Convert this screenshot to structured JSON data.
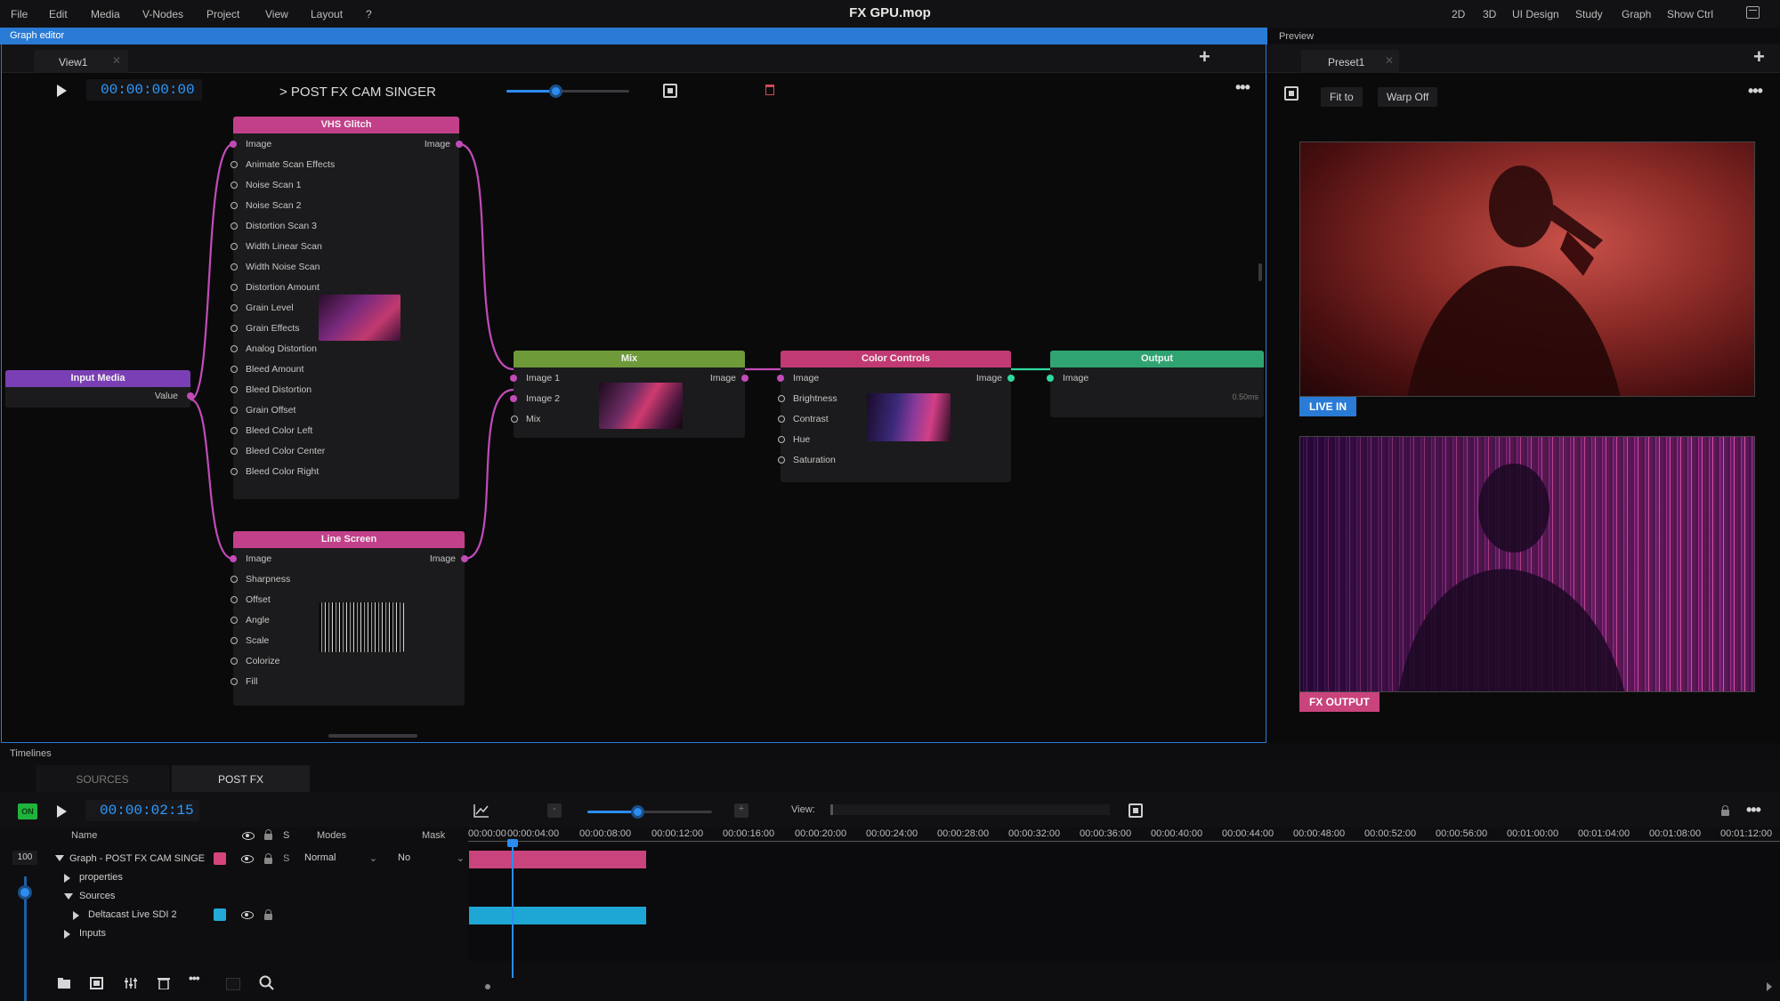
{
  "menubar": {
    "items": [
      "File",
      "Edit",
      "Media",
      "V-Nodes",
      "Project",
      "View",
      "Layout",
      "?"
    ],
    "title": "FX GPU.mop",
    "workspaces": [
      "2D",
      "3D",
      "UI Design",
      "Study",
      "Graph",
      "Show Ctrl"
    ]
  },
  "graph_editor": {
    "title": "Graph editor",
    "tab": "View1",
    "timecode": "00:00:00:00",
    "breadcrumb": "> POST FX CAM SINGER",
    "zoom_level": 0.4,
    "nodes": {
      "vhs": {
        "title": "VHS Glitch",
        "input": "Image",
        "output": "Image",
        "params": [
          "Animate Scan Effects",
          "Noise Scan 1",
          "Noise Scan 2",
          "Distortion Scan 3",
          "Width Linear Scan",
          "Width Noise Scan",
          "Distortion Amount",
          "Grain Level",
          "Grain Effects",
          "Analog Distortion",
          "Bleed Amount",
          "Bleed Distortion",
          "Grain Offset",
          "Bleed Color Left",
          "Bleed Color Center",
          "Bleed Color Right"
        ]
      },
      "input_media": {
        "title": "Input Media",
        "output": "Value"
      },
      "line_screen": {
        "title": "Line Screen",
        "input": "Image",
        "output": "Image",
        "params": [
          "Sharpness",
          "Offset",
          "Angle",
          "Scale",
          "Colorize",
          "Fill"
        ]
      },
      "mix": {
        "title": "Mix",
        "inputs": [
          "Image 1",
          "Image 2",
          "Mix"
        ],
        "output": "Image"
      },
      "color": {
        "title": "Color Controls",
        "input": "Image",
        "output": "Image",
        "params": [
          "Brightness",
          "Contrast",
          "Hue",
          "Saturation"
        ]
      },
      "output": {
        "title": "Output",
        "input": "Image",
        "timing": "0.50ms"
      }
    },
    "colors": {
      "accent": "#2a7bd5",
      "vhs": "#c2408a",
      "input_media": "#7b3fb5",
      "mix": "#6e9a3a",
      "color": "#c23a73",
      "output": "#2fa472",
      "wire": "#c24bb8"
    }
  },
  "preview": {
    "title": "Preview",
    "tab": "Preset1",
    "fit_label": "Fit to",
    "warp_label": "Warp Off",
    "live_label": "LIVE IN",
    "fx_label": "FX OUTPUT"
  },
  "timelines": {
    "title": "Timelines",
    "tabs": [
      "SOURCES",
      "POST FX"
    ],
    "on_label": "ON",
    "timecode": "00:00:02:15",
    "view_label": "View:",
    "zoom_level": 0.4,
    "columns": {
      "name": "Name",
      "solo": "S",
      "modes": "Modes",
      "mask": "Mask"
    },
    "opacity": "100",
    "ruler": [
      "00:00:00",
      "00:00:04:00",
      "00:00:08:00",
      "00:00:12:00",
      "00:00:16:00",
      "00:00:20:00",
      "00:00:24:00",
      "00:00:28:00",
      "00:00:32:00",
      "00:00:36:00",
      "00:00:40:00",
      "00:00:44:00",
      "00:00:48:00",
      "00:00:52:00",
      "00:00:56:00",
      "00:01:00:00",
      "00:01:04:00",
      "00:01:08:00",
      "00:01:12:00"
    ],
    "rows": {
      "graph": {
        "name": "Graph - POST FX CAM SINGE",
        "solo": "S",
        "mode": "Normal",
        "mask": "No"
      },
      "properties": "properties",
      "sources": "Sources",
      "deltacast": "Deltacast Live SDI 2",
      "inputs": "Inputs"
    }
  }
}
